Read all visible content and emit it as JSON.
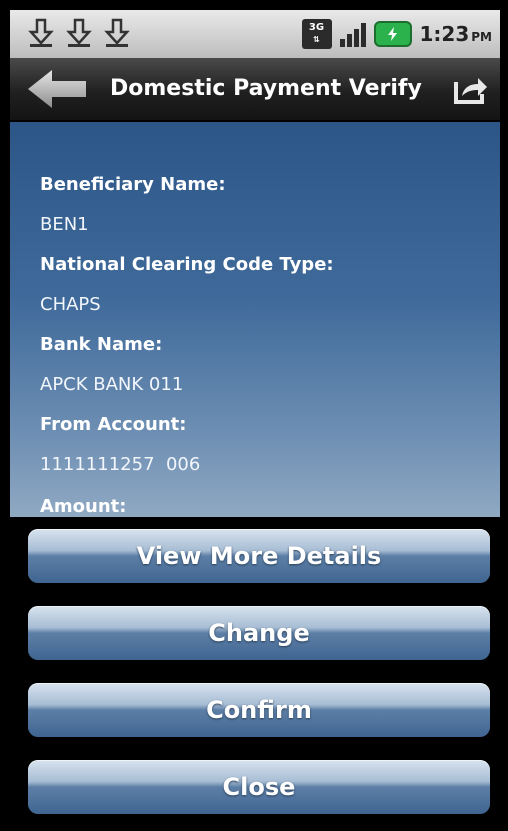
{
  "status_bar": {
    "network_type": "3G",
    "time": "1:23",
    "ampm": "PM"
  },
  "header": {
    "title": "Domestic Payment Verify"
  },
  "details": [
    {
      "label": "Beneficiary Name:",
      "value": "BEN1"
    },
    {
      "label": "National Clearing Code Type:",
      "value": "CHAPS"
    },
    {
      "label": "Bank Name:",
      "value": "APCK BANK 011"
    },
    {
      "label": "From Account:",
      "value": "1111111257  006"
    },
    {
      "label": "Amount:",
      "value": ""
    }
  ],
  "buttons": {
    "view_more": "View More Details",
    "change": "Change",
    "confirm": "Confirm",
    "close": "Close"
  },
  "colors": {
    "content_top": "#2b5687",
    "content_bottom": "#90a9c3",
    "button_blue": "#3f6591",
    "battery_green": "#2bb24c"
  }
}
